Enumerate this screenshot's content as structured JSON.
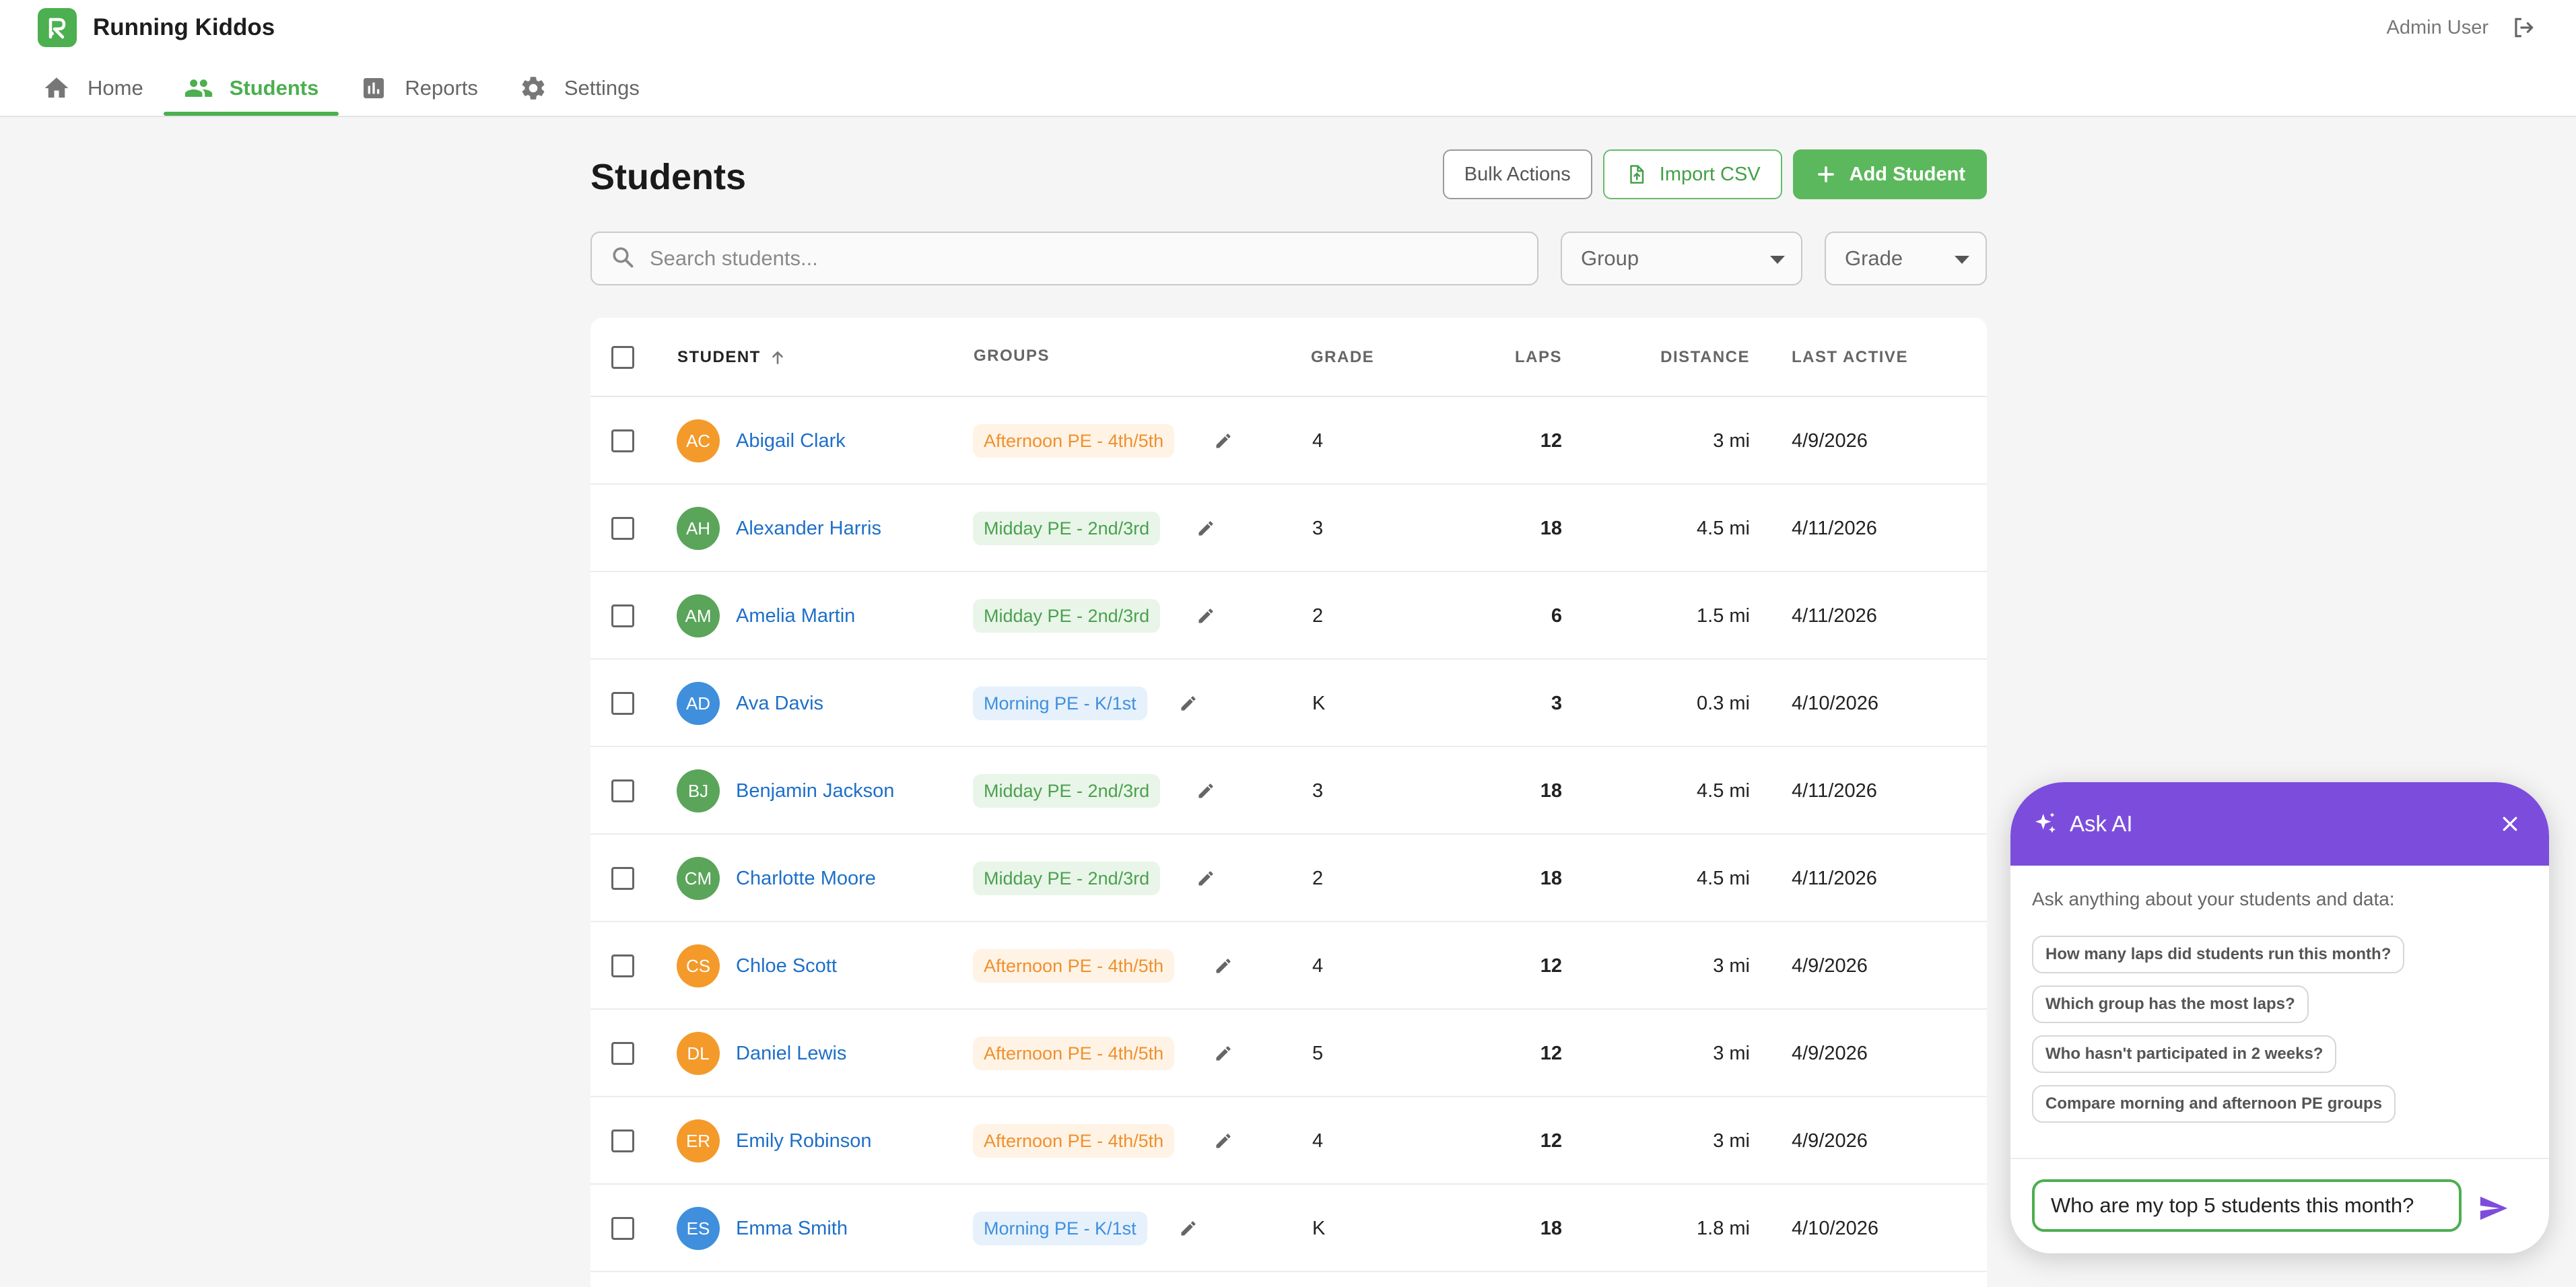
{
  "app": {
    "name": "Running Kiddos",
    "user": "Admin User"
  },
  "nav": {
    "tabs": [
      {
        "label": "Home",
        "icon": "home-icon"
      },
      {
        "label": "Students",
        "icon": "people-icon",
        "active": true
      },
      {
        "label": "Reports",
        "icon": "bar-chart-icon"
      },
      {
        "label": "Settings",
        "icon": "gear-icon"
      }
    ]
  },
  "page": {
    "title": "Students",
    "actions": {
      "bulk": "Bulk Actions",
      "import": "Import CSV",
      "add": "Add Student"
    },
    "search_placeholder": "Search students...",
    "filters": {
      "group": "Group",
      "grade": "Grade"
    }
  },
  "table": {
    "headers": {
      "student": "STUDENT",
      "groups": "GROUPS",
      "grade": "GRADE",
      "laps": "LAPS",
      "distance": "DISTANCE",
      "last_active": "LAST ACTIVE"
    },
    "sort": {
      "column": "student",
      "direction": "ascending"
    },
    "rows": [
      {
        "initials": "AC",
        "name": "Abigail Clark",
        "group": "Afternoon PE - 4th/5th",
        "group_color": "orange",
        "grade": "4",
        "laps": "12",
        "distance": "3 mi",
        "last_active": "4/9/2026"
      },
      {
        "initials": "AH",
        "name": "Alexander Harris",
        "group": "Midday PE - 2nd/3rd",
        "group_color": "green",
        "grade": "3",
        "laps": "18",
        "distance": "4.5 mi",
        "last_active": "4/11/2026"
      },
      {
        "initials": "AM",
        "name": "Amelia Martin",
        "group": "Midday PE - 2nd/3rd",
        "group_color": "green",
        "grade": "2",
        "laps": "6",
        "distance": "1.5 mi",
        "last_active": "4/11/2026"
      },
      {
        "initials": "AD",
        "name": "Ava Davis",
        "group": "Morning PE - K/1st",
        "group_color": "blue",
        "grade": "K",
        "laps": "3",
        "distance": "0.3 mi",
        "last_active": "4/10/2026"
      },
      {
        "initials": "BJ",
        "name": "Benjamin Jackson",
        "group": "Midday PE - 2nd/3rd",
        "group_color": "green",
        "grade": "3",
        "laps": "18",
        "distance": "4.5 mi",
        "last_active": "4/11/2026"
      },
      {
        "initials": "CM",
        "name": "Charlotte Moore",
        "group": "Midday PE - 2nd/3rd",
        "group_color": "green",
        "grade": "2",
        "laps": "18",
        "distance": "4.5 mi",
        "last_active": "4/11/2026"
      },
      {
        "initials": "CS",
        "name": "Chloe Scott",
        "group": "Afternoon PE - 4th/5th",
        "group_color": "orange",
        "grade": "4",
        "laps": "12",
        "distance": "3 mi",
        "last_active": "4/9/2026"
      },
      {
        "initials": "DL",
        "name": "Daniel Lewis",
        "group": "Afternoon PE - 4th/5th",
        "group_color": "orange",
        "grade": "5",
        "laps": "12",
        "distance": "3 mi",
        "last_active": "4/9/2026"
      },
      {
        "initials": "ER",
        "name": "Emily Robinson",
        "group": "Afternoon PE - 4th/5th",
        "group_color": "orange",
        "grade": "4",
        "laps": "12",
        "distance": "3 mi",
        "last_active": "4/9/2026"
      },
      {
        "initials": "ES",
        "name": "Emma Smith",
        "group": "Morning PE - K/1st",
        "group_color": "blue",
        "grade": "K",
        "laps": "18",
        "distance": "1.8 mi",
        "last_active": "4/10/2026"
      }
    ]
  },
  "colors": {
    "brand": "#4caf50",
    "ai_header": "#7c4ddc",
    "link": "#1e6fc8",
    "group_orange": "#f0902c",
    "group_green": "#4aa14e",
    "group_blue": "#3e8fde"
  },
  "ai": {
    "title": "Ask AI",
    "intro": "Ask anything about your students and data:",
    "suggestions": [
      "How many laps did students run this month?",
      "Which group has the most laps?",
      "Who hasn't participated in 2 weeks?",
      "Compare morning and afternoon PE groups"
    ],
    "input_value": "Who are my top 5 students this month?"
  }
}
